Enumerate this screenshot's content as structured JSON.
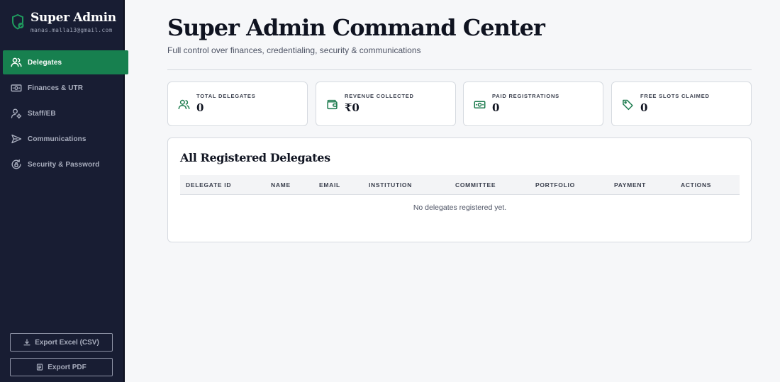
{
  "sidebar": {
    "brand_title": "Super Admin",
    "brand_email": "manas.malla13@gmail.com",
    "items": [
      {
        "label": "Delegates",
        "icon": "users-icon",
        "active": true
      },
      {
        "label": "Finances & UTR",
        "icon": "banknote-icon",
        "active": false
      },
      {
        "label": "Staff/EB",
        "icon": "user-cog-icon",
        "active": false
      },
      {
        "label": "Communications",
        "icon": "send-icon",
        "active": false
      },
      {
        "label": "Security & Password",
        "icon": "lock-refresh-icon",
        "active": false
      }
    ],
    "export_excel": "Export Excel (CSV)",
    "export_pdf": "Export PDF"
  },
  "header": {
    "title": "Super Admin Command Center",
    "subtitle": "Full control over finances, credentialing, security & communications"
  },
  "stats": [
    {
      "label": "TOTAL DELEGATES",
      "value": "0",
      "icon": "users-icon"
    },
    {
      "label": "REVENUE COLLECTED",
      "value": "₹0",
      "icon": "wallet-icon"
    },
    {
      "label": "PAID REGISTRATIONS",
      "value": "0",
      "icon": "banknote-icon"
    },
    {
      "label": "FREE SLOTS CLAIMED",
      "value": "0",
      "icon": "tag-icon"
    }
  ],
  "table": {
    "title": "All Registered Delegates",
    "columns": [
      "DELEGATE ID",
      "NAME",
      "EMAIL",
      "INSTITUTION",
      "COMMITTEE",
      "PORTFOLIO",
      "PAYMENT",
      "ACTIONS"
    ],
    "empty_message": "No delegates registered yet."
  },
  "colors": {
    "sidebar_bg": "#181d33",
    "accent": "#17804f",
    "icon_green": "#1a7a4c",
    "page_bg": "#f6f7f9"
  }
}
